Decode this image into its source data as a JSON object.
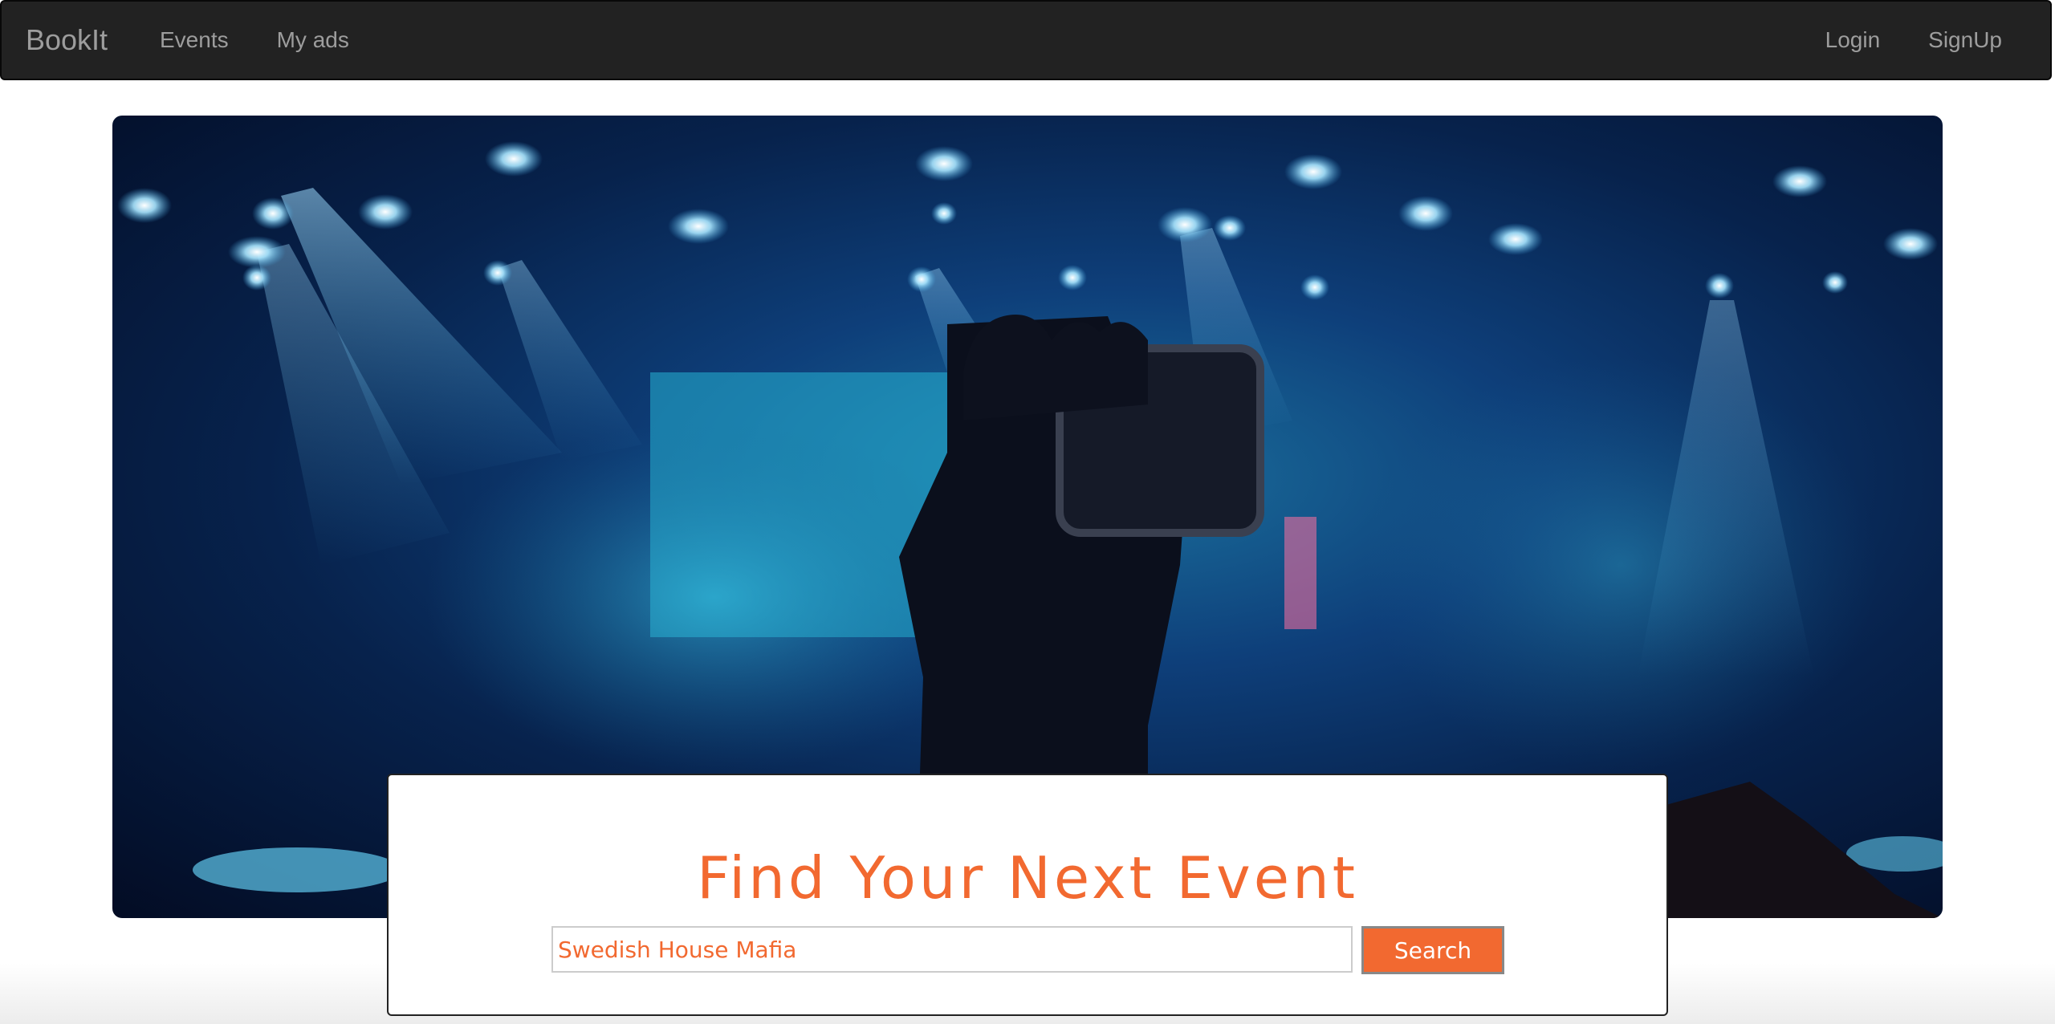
{
  "navbar": {
    "brand": "BookIt",
    "left_links": [
      "Events",
      "My ads"
    ],
    "right_links": [
      "Login",
      "SignUp"
    ]
  },
  "hero": {
    "alt": "concert-crowd-photo"
  },
  "search": {
    "title": "Find Your Next Event",
    "input_value": "Swedish House Mafia",
    "button_label": "Search"
  },
  "colors": {
    "accent": "#f26930",
    "navbar_bg": "#222222",
    "nav_text": "#9d9d9d"
  }
}
